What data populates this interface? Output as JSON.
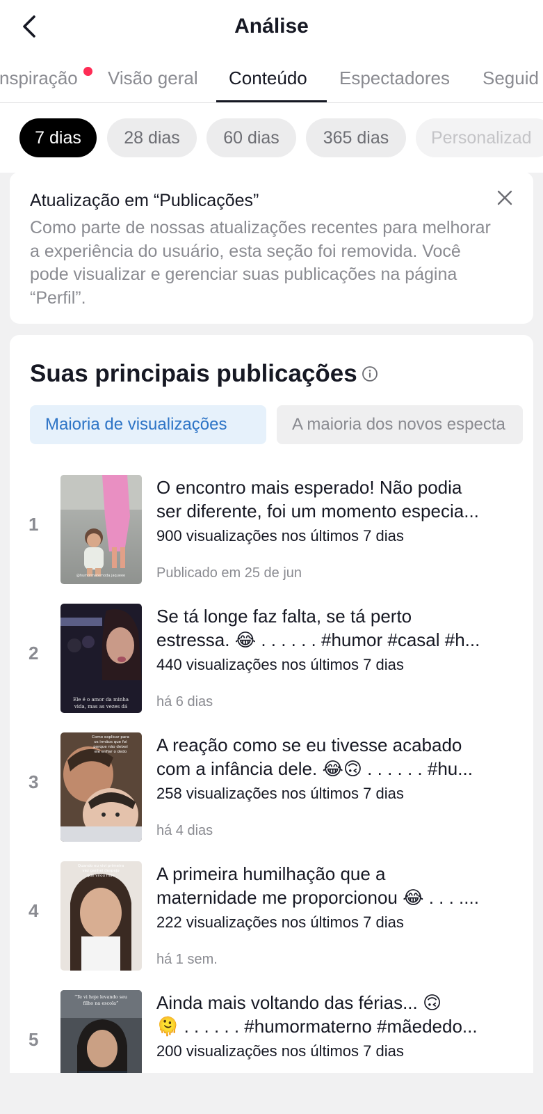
{
  "header": {
    "title": "Análise"
  },
  "tabs": [
    "nspiração",
    "Visão geral",
    "Conteúdo",
    "Espectadores",
    "Seguid"
  ],
  "active_tab": "Conteúdo",
  "date_filters": [
    "7 dias",
    "28 dias",
    "60 dias",
    "365 dias",
    "Personalizad"
  ],
  "active_filter": "7 dias",
  "notice": {
    "title": "Atualização em “Publicações”",
    "body": "Como parte de nossas atualizações recentes para melhorar a experiência do usuário, esta seção foi removida. Você pode visualizar e gerenciar suas publicações na página “Perfil”."
  },
  "top_posts": {
    "title": "Suas principais publicações",
    "sort_options": [
      "Maioria de visualizações",
      "A maioria dos novos especta"
    ],
    "active_sort": "Maioria de visualizações",
    "items": [
      {
        "rank": "1",
        "title_line1": "O encontro mais esperado! Não podia",
        "title_line2": "ser diferente, foi um momento especia...",
        "views": "900 visualizações nos últimos 7 dias",
        "date": "Publicado em 25 de jun",
        "thumb_text": "@humormaternoda.jaqueee"
      },
      {
        "rank": "2",
        "title_line1": "Se tá longe faz falta, se tá perto",
        "title_line2": "estressa. 😂 . . . . . . #humor #casal #h...",
        "views": "440 visualizações nos últimos 7 dias",
        "date": "há 6 dias",
        "thumb_text": "Ele é o amor da minha vida, mas as vezes dá"
      },
      {
        "rank": "3",
        "title_line1": "A reação como se eu tivesse acabado",
        "title_line2": "com a infância dele. 😂🙃 . . . . . . #hu...",
        "views": "258 visualizações nos últimos 7 dias",
        "date": "há 4 dias",
        "thumb_text": "Como explicar para os irmãos que foi porque não deixei ele enfiar o dedo no olho do irmão?"
      },
      {
        "rank": "4",
        "title_line1": "A primeira humilhação que a",
        "title_line2": "maternidade me proporcionou 😂 . . . ....",
        "views": "222 visualizações nos últimos 7 dias",
        "date": "há 1 sem.",
        "thumb_text": "Quando eu vivi primeira vez ganhei despejo que virou mãe"
      },
      {
        "rank": "5",
        "title_line1": "Ainda mais voltando das férias... 🙃",
        "title_line2": "🫠 . . . . . . #humormaterno #mãededo...",
        "views": "200 visualizações nos últimos 7 dias",
        "date": "",
        "thumb_text": "“Te vi hoje levando seu filho na escola”"
      }
    ]
  }
}
